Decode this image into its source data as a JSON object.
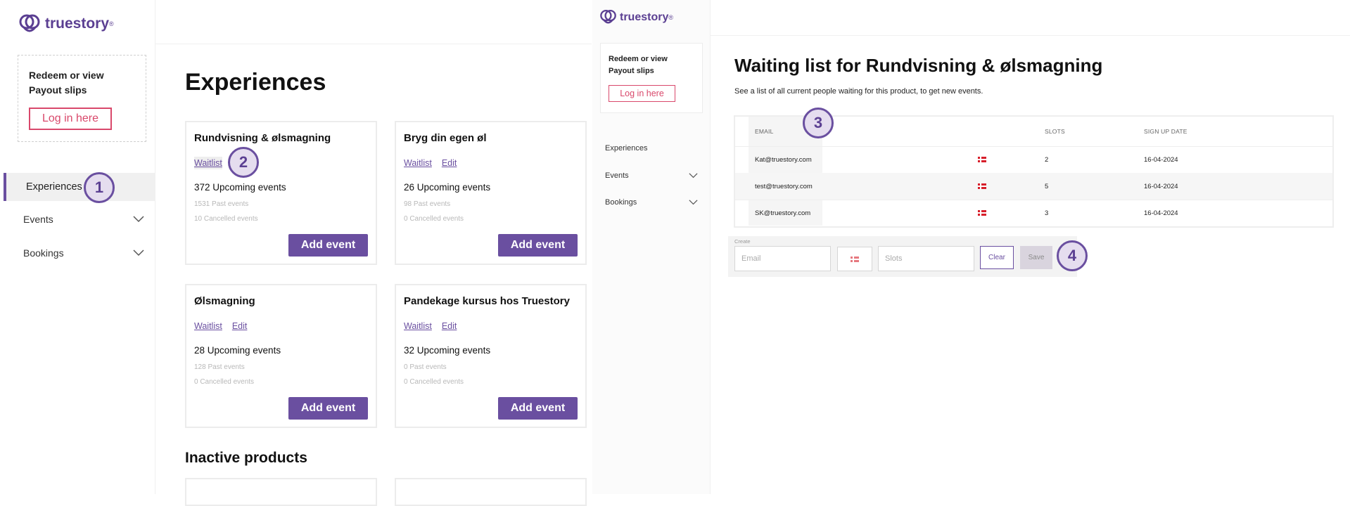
{
  "brand": {
    "name": "truestory",
    "reg": "®",
    "color": "#5b3f92"
  },
  "redeem": {
    "line1": "Redeem or view",
    "line2": "Payout slips",
    "login": "Log in here"
  },
  "nav": {
    "experiences": "Experiences",
    "events": "Events",
    "bookings": "Bookings"
  },
  "markers": {
    "m1": "1",
    "m2": "2",
    "m3": "3",
    "m4": "4"
  },
  "page": {
    "title": "Experiences",
    "inactive_title": "Inactive products",
    "waitlist_label": "Waitlist",
    "edit_label": "Edit",
    "add_event_label": "Add event",
    "cards": [
      {
        "title": "Rundvisning & ølsmagning",
        "upcoming": "372 Upcoming events",
        "past": "1531 Past events",
        "cancelled": "10 Cancelled events"
      },
      {
        "title": "Bryg din egen øl",
        "upcoming": "26 Upcoming events",
        "past": "98 Past events",
        "cancelled": "0 Cancelled events"
      },
      {
        "title": "Ølsmagning",
        "upcoming": "28 Upcoming events",
        "past": "128 Past events",
        "cancelled": "0 Cancelled events"
      },
      {
        "title": "Pandekage kursus hos Truestory",
        "upcoming": "32 Upcoming events",
        "past": "0 Past events",
        "cancelled": "0 Cancelled events"
      }
    ]
  },
  "waitlist": {
    "title": "Waiting list for Rundvisning & ølsmagning",
    "subtitle": "See a list of all current people waiting for this product, to get new events.",
    "columns": {
      "email": "EMAIL",
      "slots": "SLOTS",
      "signup": "SIGN UP DATE"
    },
    "rows": [
      {
        "email": "Kat@truestory.com",
        "slots": "2",
        "date": "16-04-2024"
      },
      {
        "email": "test@truestory.com",
        "slots": "5",
        "date": "16-04-2024"
      },
      {
        "email": "SK@truestory.com",
        "slots": "3",
        "date": "16-04-2024"
      }
    ],
    "create": {
      "label": "Create",
      "email_placeholder": "Email",
      "slots_placeholder": "Slots",
      "clear": "Clear",
      "save": "Save"
    }
  },
  "colors": {
    "accent": "#6a4fa0",
    "login": "#d9486b",
    "flag": "#d71f2b"
  }
}
